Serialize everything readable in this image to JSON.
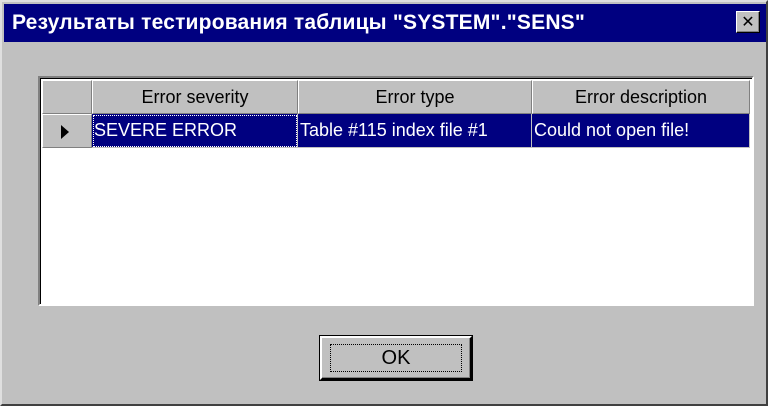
{
  "window": {
    "title": "Результаты тестирования таблицы \"SYSTEM\".\"SENS\"",
    "close_icon": "close-icon",
    "close_glyph": "✕"
  },
  "grid": {
    "columns": [
      "Error severity",
      "Error type",
      "Error description"
    ],
    "rows": [
      {
        "indicator_icon": "row-pointer-icon",
        "cells": [
          "SEVERE ERROR",
          "Table #115 index file #1",
          "Could not open file!"
        ]
      }
    ]
  },
  "buttons": {
    "ok_label": "OK"
  },
  "colors": {
    "dialog_face": "#c0c0c0",
    "title_bar": "#000080",
    "selection": "#000080",
    "grid_background": "#ffffff"
  }
}
